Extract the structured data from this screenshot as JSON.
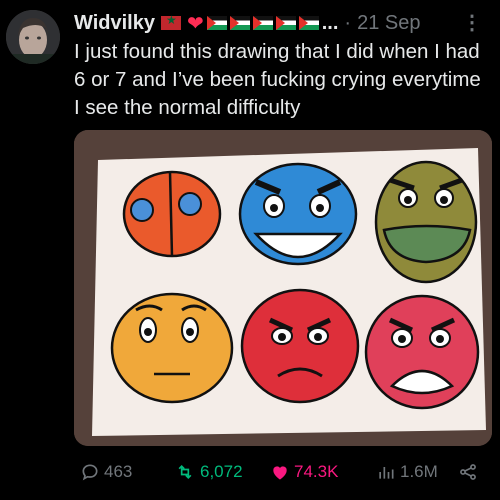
{
  "tweet": {
    "author_name": "Widvilky",
    "ellipsis": "...",
    "separator": "·",
    "date": "21 Sep",
    "text": "I just found this drawing that I did when I had 6 or 7 and I’ve been fucking crying everytime I see the normal difficulty"
  },
  "icons": [
    "avatar",
    "morocco-flag-icon",
    "red-heart-icon",
    "palestine-flag-icon",
    "more-icon",
    "reply-icon",
    "retweet-icon",
    "like-icon",
    "views-icon",
    "share-icon"
  ],
  "colors": {
    "background": "#000000",
    "text": "#e7e9ea",
    "muted": "#71767b",
    "retweet_active": "#00ba7c",
    "like_active": "#f91880"
  },
  "actions": {
    "replies": "463",
    "retweets": "6,072",
    "likes": "74.3K",
    "views": "1.6M"
  }
}
